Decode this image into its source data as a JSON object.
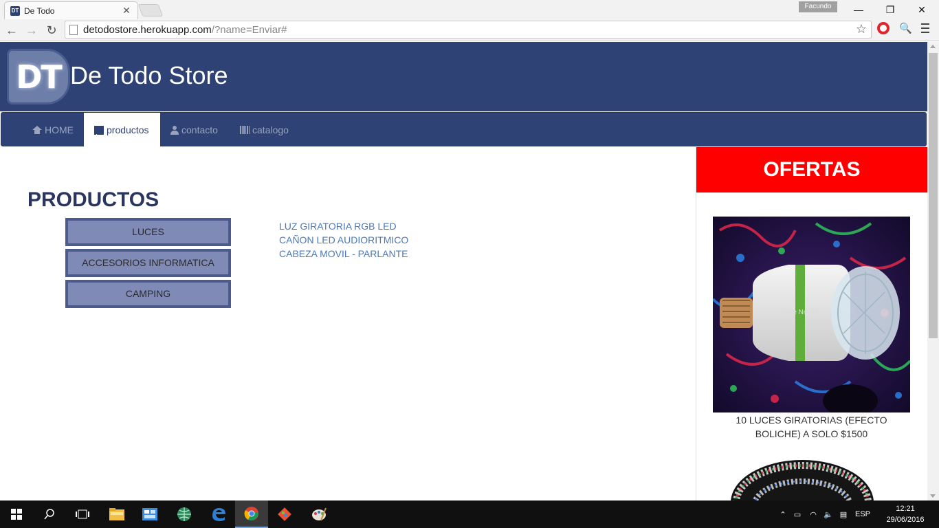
{
  "browser": {
    "tab_title": "De Todo",
    "tab_favicon_text": "DT",
    "profile_name": "Facundo",
    "url_host": "detodostore.herokuapp.com",
    "url_rest": "/?name=Enviar#"
  },
  "site": {
    "logo_text": "DT",
    "title": "De Todo Store",
    "nav": [
      {
        "label": "HOME",
        "icon": "home-icon",
        "active": false
      },
      {
        "label": "productos",
        "icon": "list-icon",
        "active": true
      },
      {
        "label": "contacto",
        "icon": "user-icon",
        "active": false
      },
      {
        "label": "catalogo",
        "icon": "barcode-icon",
        "active": false
      }
    ]
  },
  "main": {
    "section_title": "PRODUCTOS",
    "categories": [
      "LUCES",
      "ACCESORIOS INFORMATICA",
      "CAMPING"
    ],
    "products": [
      "LUZ GIRATORIA RGB LED",
      "CAÑON LED AUDIORITMICO",
      "CABEZA MOVIL - PARLANTE"
    ]
  },
  "ofertas": {
    "title": "OFERTAS",
    "offer1_watermark": "Store No: 61",
    "offer1_caption_line1": "10 LUCES GIRATORIAS (EFECTO",
    "offer1_caption_line2": "BOLICHE) A SOLO $1500"
  },
  "taskbar": {
    "language": "ESP",
    "time": "12:21",
    "date": "29/06/2016"
  },
  "colors": {
    "brand_navy": "#2f4275",
    "ofertas_red": "#ff0000",
    "category_fill": "#7f8ab6",
    "link_blue": "#4a78b8"
  }
}
